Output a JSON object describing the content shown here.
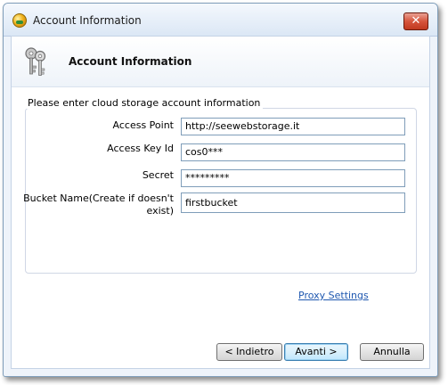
{
  "window": {
    "title": "Account Information",
    "close_label": "✕"
  },
  "header": {
    "title": "Account Information"
  },
  "group": {
    "legend": "Please enter cloud storage account information"
  },
  "fields": [
    {
      "label": "Access Point",
      "value": "http://seewebstorage.it"
    },
    {
      "label": "Access Key Id",
      "value": "cos0***"
    },
    {
      "label": "Secret",
      "value": "*********"
    },
    {
      "label": "Bucket Name(Create if doesn't exist)",
      "value": "firstbucket"
    }
  ],
  "proxy_link": "Proxy Settings",
  "buttons": {
    "back": "< Indietro",
    "next": "Avanti >",
    "cancel": "Annulla"
  },
  "icons": {
    "app": "app-globe-icon",
    "header": "keys-icon",
    "close": "close-icon"
  }
}
